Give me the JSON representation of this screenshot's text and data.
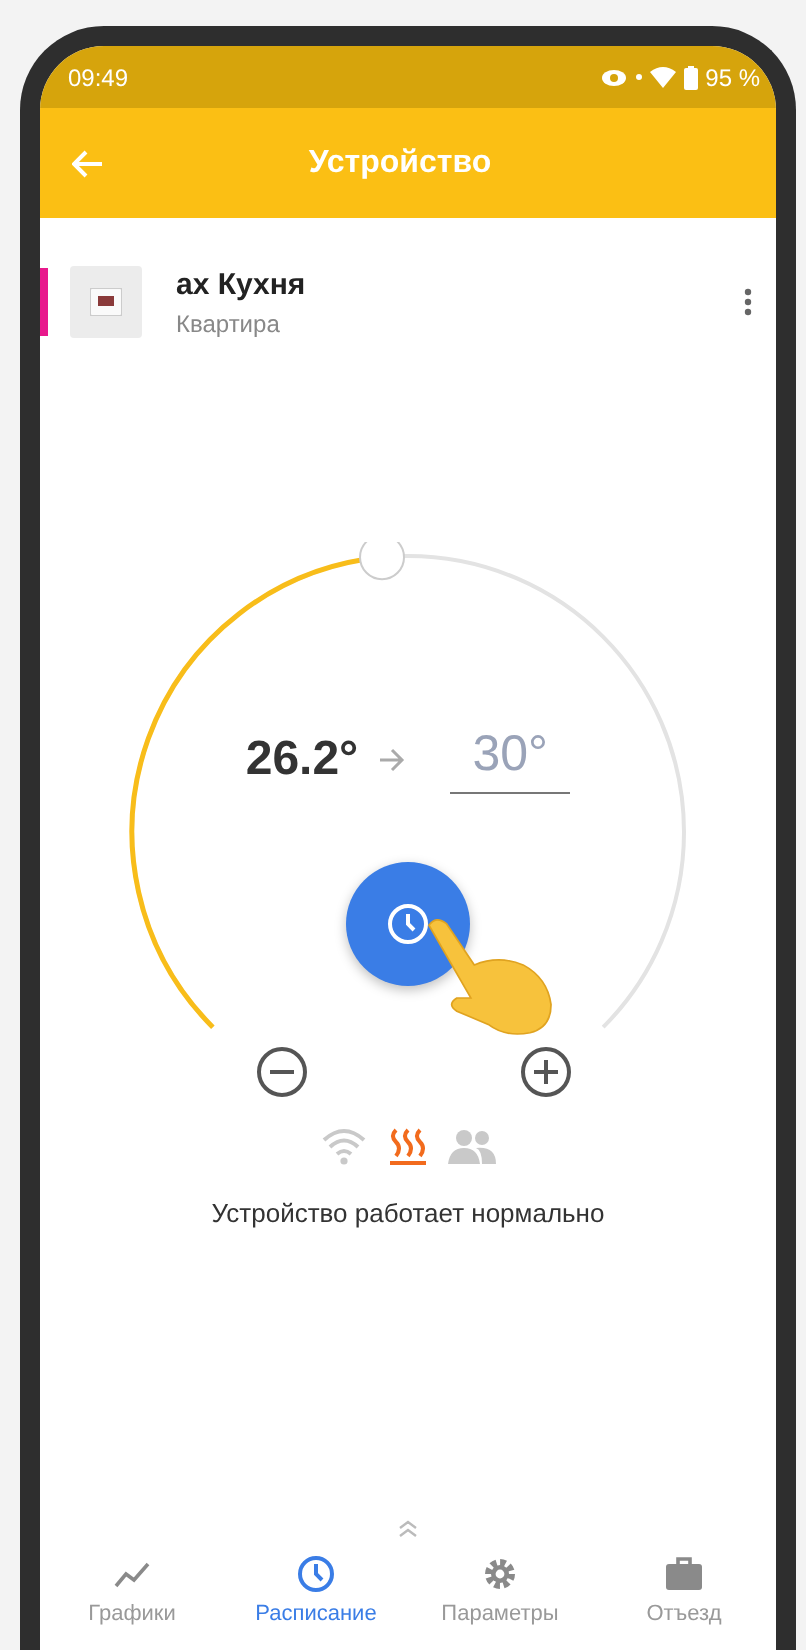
{
  "status_bar": {
    "time": "09:49",
    "battery": "95 %"
  },
  "app_bar": {
    "title": "Устройство"
  },
  "device": {
    "name": "ах Кухня",
    "location": "Квартира"
  },
  "thermostat": {
    "current": "26.2°",
    "target": "30°",
    "level": 0.48,
    "status": "Устройство работает нормально",
    "indicators": [
      {
        "kind": "wifi",
        "on": false
      },
      {
        "kind": "heating",
        "on": true
      },
      {
        "kind": "presence",
        "on": false
      }
    ]
  },
  "nav": [
    {
      "kind": "charts",
      "label": "Графики",
      "selected": false
    },
    {
      "kind": "schedule",
      "label": "Расписание",
      "selected": true
    },
    {
      "kind": "settings",
      "label": "Параметры",
      "selected": false
    },
    {
      "kind": "away",
      "label": "Отъезд",
      "selected": false
    }
  ]
}
